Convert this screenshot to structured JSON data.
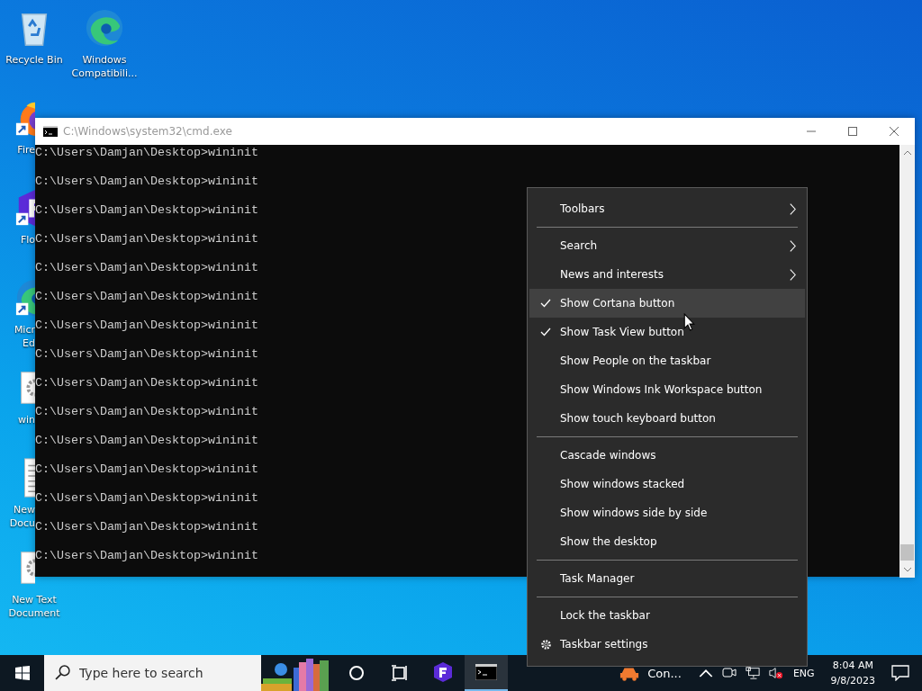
{
  "desktop_icons": [
    {
      "kind": "recycle",
      "shortcut": false,
      "lines": [
        "Recycle Bin"
      ]
    },
    {
      "kind": "edge",
      "shortcut": false,
      "lines": [
        "Windows",
        "Compatibili..."
      ]
    },
    {
      "kind": "firefox",
      "shortcut": true,
      "lines": [
        "Fire"
      ]
    },
    {
      "kind": "flo",
      "shortcut": true,
      "lines": [
        "Flo"
      ]
    },
    {
      "kind": "edge",
      "shortcut": true,
      "lines": [
        "Micr",
        "Ed"
      ]
    },
    {
      "kind": "gearfile",
      "shortcut": false,
      "lines": [
        "win"
      ]
    },
    {
      "kind": "textfile",
      "shortcut": false,
      "lines": [
        "New",
        "Docu"
      ]
    },
    {
      "kind": "gearfile",
      "shortcut": false,
      "lines": [
        "New Text",
        "Document"
      ]
    }
  ],
  "console_window": {
    "title": "C:\\Windows\\system32\\cmd.exe",
    "lines": [
      "C:\\Users\\Damjan\\Desktop>wininit",
      "C:\\Users\\Damjan\\Desktop>wininit",
      "C:\\Users\\Damjan\\Desktop>wininit",
      "C:\\Users\\Damjan\\Desktop>wininit",
      "C:\\Users\\Damjan\\Desktop>wininit",
      "C:\\Users\\Damjan\\Desktop>wininit",
      "C:\\Users\\Damjan\\Desktop>wininit",
      "C:\\Users\\Damjan\\Desktop>wininit",
      "C:\\Users\\Damjan\\Desktop>wininit",
      "C:\\Users\\Damjan\\Desktop>wininit",
      "C:\\Users\\Damjan\\Desktop>wininit",
      "C:\\Users\\Damjan\\Desktop>wininit",
      "C:\\Users\\Damjan\\Desktop>wininit",
      "C:\\Users\\Damjan\\Desktop>wininit",
      "C:\\Users\\Damjan\\Desktop>wininit"
    ]
  },
  "context_menu": {
    "groups": [
      [
        {
          "label": "Toolbars",
          "kind": "plain",
          "submenu": true,
          "checked": false,
          "highlighted": false
        }
      ],
      [
        {
          "label": "Search",
          "kind": "plain",
          "submenu": true,
          "checked": false,
          "highlighted": false
        },
        {
          "label": "News and interests",
          "kind": "plain",
          "submenu": true,
          "checked": false,
          "highlighted": false
        },
        {
          "label": "Show Cortana button",
          "kind": "plain",
          "submenu": false,
          "checked": true,
          "highlighted": true
        },
        {
          "label": "Show Task View button",
          "kind": "plain",
          "submenu": false,
          "checked": true,
          "highlighted": false
        },
        {
          "label": "Show People on the taskbar",
          "kind": "plain",
          "submenu": false,
          "checked": false,
          "highlighted": false
        },
        {
          "label": "Show Windows Ink Workspace button",
          "kind": "plain",
          "submenu": false,
          "checked": false,
          "highlighted": false
        },
        {
          "label": "Show touch keyboard button",
          "kind": "plain",
          "submenu": false,
          "checked": false,
          "highlighted": false
        }
      ],
      [
        {
          "label": "Cascade windows",
          "kind": "plain",
          "submenu": false,
          "checked": false,
          "highlighted": false
        },
        {
          "label": "Show windows stacked",
          "kind": "plain",
          "submenu": false,
          "checked": false,
          "highlighted": false
        },
        {
          "label": "Show windows side by side",
          "kind": "plain",
          "submenu": false,
          "checked": false,
          "highlighted": false
        },
        {
          "label": "Show the desktop",
          "kind": "plain",
          "submenu": false,
          "checked": false,
          "highlighted": false
        }
      ],
      [
        {
          "label": "Task Manager",
          "kind": "plain",
          "submenu": false,
          "checked": false,
          "highlighted": false
        }
      ],
      [
        {
          "label": "Lock the taskbar",
          "kind": "plain",
          "submenu": false,
          "checked": false,
          "highlighted": false
        },
        {
          "label": "Taskbar settings",
          "kind": "settings",
          "submenu": false,
          "checked": false,
          "highlighted": false
        }
      ]
    ]
  },
  "taskbar": {
    "search_placeholder": "Type here to search",
    "apps": [
      {
        "kind": "flo",
        "active": false
      },
      {
        "kind": "console",
        "active": true
      }
    ],
    "tray_app_label": "Con...",
    "language": "ENG",
    "time": "8:04 AM",
    "date": "9/8/2023"
  }
}
